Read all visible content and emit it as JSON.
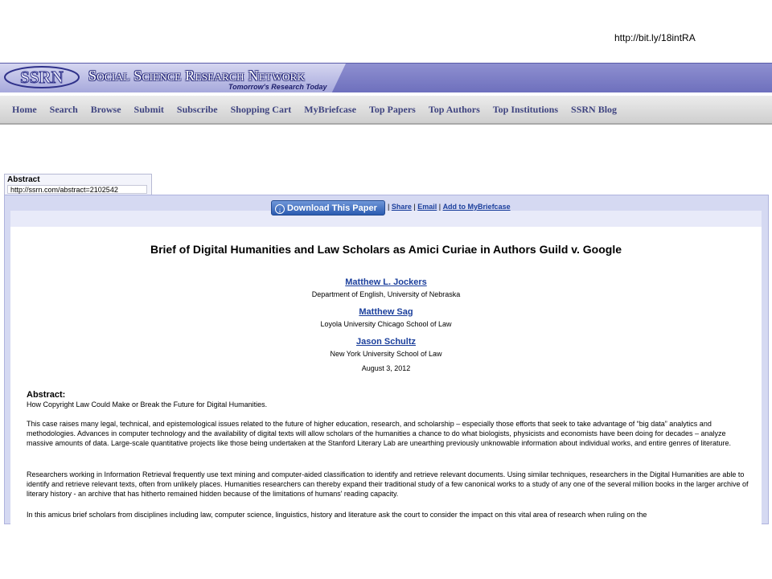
{
  "shortlink": "http://bit.ly/18intRA",
  "site": {
    "logo_text": "SSRN",
    "title": "Social Science Research Network",
    "tagline": "Tomorrow's Research Today"
  },
  "nav": {
    "items": [
      "Home",
      "Search",
      "Browse",
      "Submit",
      "Subscribe",
      "Shopping Cart",
      "MyBriefcase",
      "Top Papers",
      "Top Authors",
      "Top Institutions",
      "SSRN Blog"
    ]
  },
  "abstract_tab": {
    "label": "Abstract",
    "url": "http://ssrn.com/abstract=2102542"
  },
  "actions": {
    "download_label": "Download This Paper",
    "share": "Share",
    "email": "Email",
    "add_to_briefcase": "Add to MyBriefcase"
  },
  "paper": {
    "title": "Brief of Digital Humanities and Law Scholars as Amici Curiae in Authors Guild v. Google",
    "authors": [
      {
        "name": "Matthew L. Jockers",
        "affiliation": "Department of English, University of Nebraska"
      },
      {
        "name": "Matthew Sag",
        "affiliation": "Loyola University Chicago School of Law"
      },
      {
        "name": "Jason Schultz",
        "affiliation": "New York University School of Law"
      }
    ],
    "date": "August 3, 2012",
    "abstract_heading": "Abstract:",
    "abstract_subtitle": "How Copyright Law Could Make or Break the Future for Digital Humanities.",
    "paragraphs": [
      "This case raises many legal, technical, and epistemological issues related to the future of higher education, research, and scholarship – especially those efforts that seek to take advantage of “big data” analytics and methodologies. Advances in computer technology and the availability of digital texts will allow scholars of the humanities a chance to do what biologists, physicists and economists have been doing for decades – analyze massive amounts of data. Large-scale quantitative projects like those being undertaken at the Stanford Literary Lab are unearthing previously unknowable information about individual works, and entire genres of literature.",
      "Researchers working in Information Retrieval frequently use text mining and computer-aided classification to identify and retrieve relevant documents. Using similar techniques, researchers in the Digital Humanities are able to identify and retrieve relevant texts, often from unlikely places. Humanities researchers can thereby expand their traditional study of a few canonical works to a study of any one of the several million books in the larger archive of literary history - an archive that has hitherto remained hidden because of the limitations of humans' reading capacity.",
      "In this amicus brief scholars from disciplines including law, computer science, linguistics, history and literature ask the court to consider the impact on this vital area of research when ruling on the"
    ]
  },
  "colors": {
    "banner": "#7577c2",
    "nav_text": "#3f4480",
    "link": "#1b3f9c",
    "frame": "#d5d9f2"
  }
}
